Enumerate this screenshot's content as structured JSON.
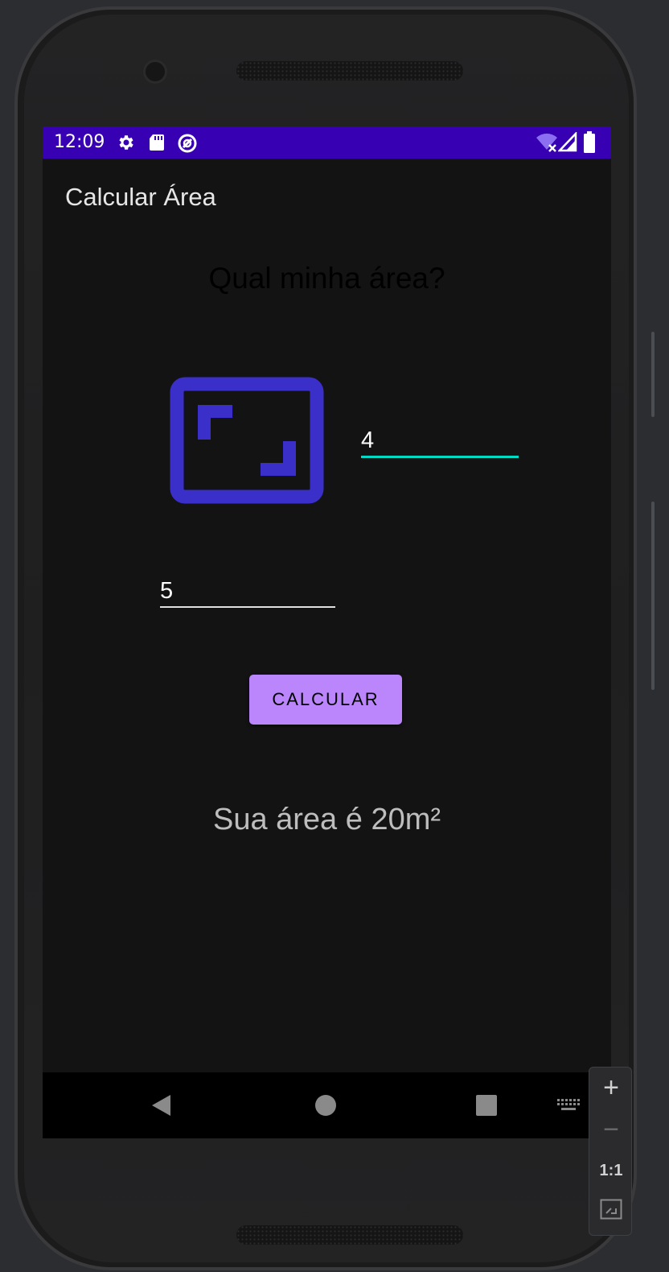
{
  "status_bar": {
    "time": "12:09",
    "left_icons": [
      "gear-icon",
      "sd-card-icon",
      "sync-icon"
    ],
    "right_icons": [
      "wifi-off-icon",
      "cell-signal-icon",
      "battery-icon"
    ],
    "color": "#3700b3"
  },
  "app_bar": {
    "title": "Calcular Área"
  },
  "main": {
    "question": "Qual minha área?",
    "width_field": {
      "value": "4",
      "focused": true
    },
    "height_field": {
      "value": "5",
      "focused": false
    },
    "calculate_button": "CALCULAR",
    "result": "Sua área é 20m²"
  },
  "nav_bar": {
    "icons": [
      "back-icon",
      "home-icon",
      "recents-icon",
      "keyboard-icon"
    ]
  },
  "zoom_controls": {
    "zoom_in": "+",
    "zoom_out": "−",
    "actual_size": "1:1",
    "fit": "fit-screen-icon"
  },
  "colors": {
    "accent": "#bb86fc",
    "focus_underline": "#03dac5",
    "icon_blue": "#3a2fc9",
    "background": "#131313"
  }
}
